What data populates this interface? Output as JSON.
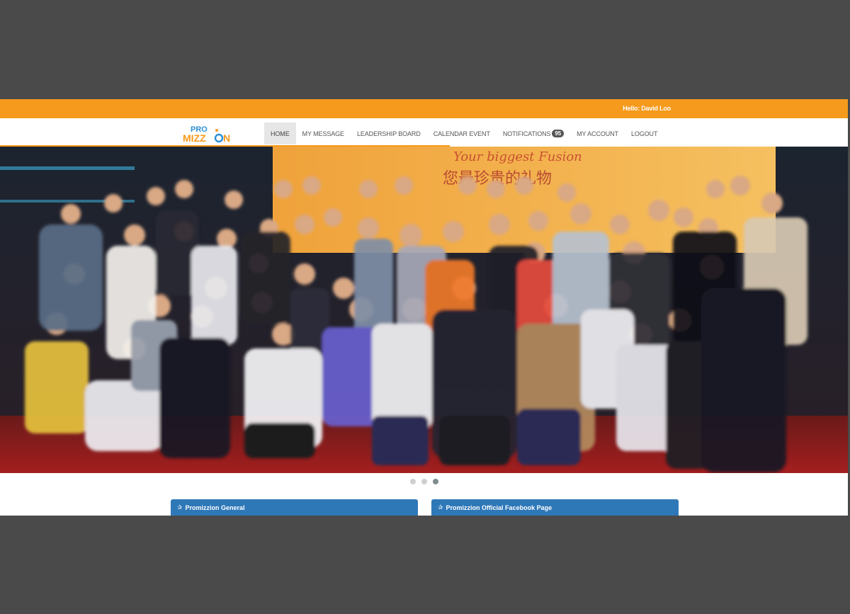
{
  "topbar": {
    "greeting": "Hello: David Loo"
  },
  "logo": {
    "line1": "PRO",
    "line2": "MIZZ",
    "line3": "N"
  },
  "nav": {
    "items": [
      {
        "label": "HOME",
        "active": true
      },
      {
        "label": "MY MESSAGE"
      },
      {
        "label": "LEADERSHIP BOARD"
      },
      {
        "label": "CALENDAR EVENT"
      },
      {
        "label": "NOTIFICATIONS",
        "badge": "95"
      },
      {
        "label": "MY ACCOUNT"
      },
      {
        "label": "LOGOUT"
      }
    ]
  },
  "hero": {
    "banner_text": "Your biggest Fusion",
    "banner_chinese": "您最珍贵的礼物",
    "slide_count": 3,
    "active_slide": 3
  },
  "panels": [
    {
      "title": "Promizzion General",
      "icon": "star-icon"
    },
    {
      "title": "Promizzion Official Facebook Page",
      "icon": "star-icon"
    }
  ],
  "colors": {
    "brand_orange": "#f59a1c",
    "panel_blue": "#2f78b8",
    "logo_blue": "#2d8fd5"
  }
}
